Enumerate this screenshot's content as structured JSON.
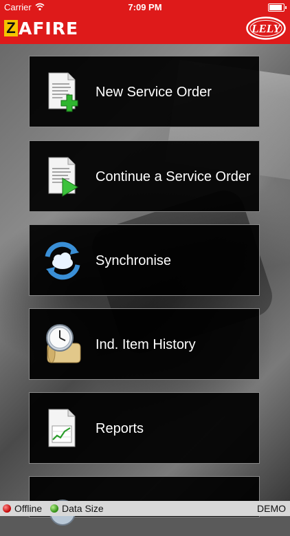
{
  "status_bar": {
    "carrier": "Carrier",
    "time": "7:09 PM"
  },
  "header": {
    "brand_letter": "Z",
    "brand_rest": "AFIRE",
    "logo_text": "LELY",
    "bg_color": "#de1a1a"
  },
  "menu": [
    {
      "label": "New Service Order",
      "icon": "document-add-icon"
    },
    {
      "label": "Continue a Service Order",
      "icon": "document-play-icon"
    },
    {
      "label": "Synchronise",
      "icon": "sync-cloud-icon"
    },
    {
      "label": "Ind. Item History",
      "icon": "clock-scroll-icon"
    },
    {
      "label": "Reports",
      "icon": "report-chart-icon"
    }
  ],
  "footer": {
    "offline": "Offline",
    "data_size": "Data Size",
    "mode": "DEMO"
  }
}
